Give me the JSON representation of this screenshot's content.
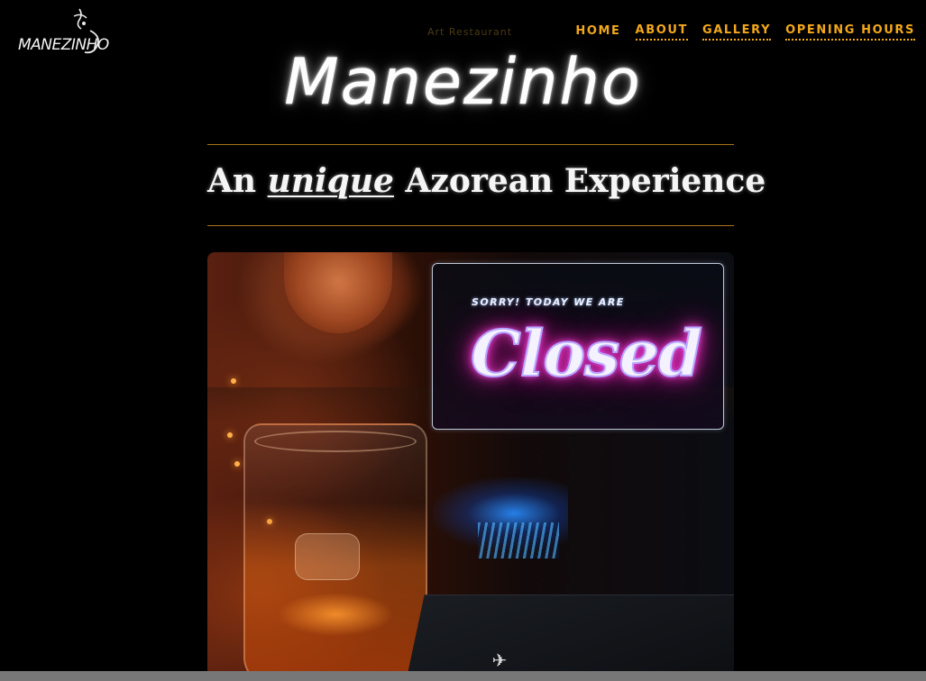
{
  "brand": {
    "logo_text": "MANEZINHO",
    "tagline": "Art Restaurant",
    "title": "Manezinho"
  },
  "nav": {
    "items": [
      {
        "label": "HOME"
      },
      {
        "label": "ABOUT"
      },
      {
        "label": "GALLERY"
      },
      {
        "label": "OPENING HOURS"
      }
    ]
  },
  "hero_heading": {
    "prefix": "An",
    "emphasis": "unique",
    "suffix": "Azorean Experience"
  },
  "status_sign": {
    "pre_text": "SORRY! TODAY WE ARE",
    "status": "Closed"
  },
  "colors": {
    "accent": "#f2a81b",
    "rule": "#a67616",
    "background": "#000000",
    "neon": "#ff3ad0"
  }
}
